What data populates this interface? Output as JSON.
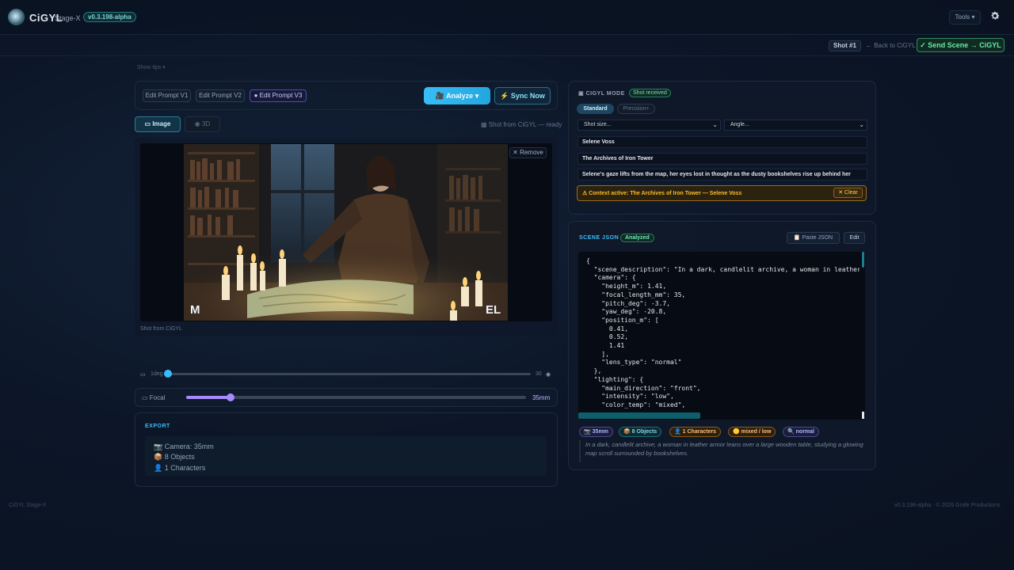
{
  "app": {
    "brand": "CiGYL",
    "stage": "Stage-X",
    "version": "v0.3.198-alpha",
    "tools_label": "Tools",
    "show_tips": "Show tips"
  },
  "subbar": {
    "shot_badge": "Shot #1",
    "back_link": "← Back to CiGYL",
    "send_button": "✓ Send Scene → CiGYL"
  },
  "editor": {
    "prompt_versions": [
      "Edit Prompt V1",
      "Edit Prompt V2",
      "● Edit Prompt V3"
    ],
    "analyze_label": "Analyze",
    "sync_label": "Sync Now",
    "tabs": {
      "image": "Image",
      "threeD": "3D"
    },
    "shot_status": "Shot from CiGYL — ready",
    "remove_label": "✕ Remove",
    "image_labels": {
      "left": "M",
      "right": "EL"
    },
    "image_caption": "Shot from CiGYL"
  },
  "sliders": {
    "deg_low": "1deg",
    "deg_high": "30",
    "deg_value": 0,
    "focal_label": "Focal",
    "focal_value_text": "35mm",
    "focal_fraction": 0.13
  },
  "export": {
    "title": "EXPORT",
    "camera": "Camera: 35mm",
    "objects": "8 Objects",
    "characters": "1 Characters"
  },
  "mode": {
    "title": "CIGYL MODE",
    "badge": "Shot received",
    "standard": "Standard",
    "precision": "Precision+",
    "shot_size_placeholder": "Shot size...",
    "angle_placeholder": "Angle...",
    "character": "Selene Voss",
    "location": "The Archives of Iron Tower",
    "description": "Selene's gaze lifts from the map, her eyes lost in thought as the dusty bookshelves rise up behind her",
    "context_text": "⚠ Context active: The Archives of Iron Tower — Selene Voss",
    "clear_label": "✕ Clear"
  },
  "scene_json": {
    "title": "SCENE JSON",
    "badge": "Analyzed",
    "paste_label": "Paste JSON",
    "edit_label": "Edit",
    "code": "{\n  \"scene_description\": \"In a dark, candlelit archive, a woman in leather\n  \"camera\": {\n    \"height_m\": 1.41,\n    \"focal_length_mm\": 35,\n    \"pitch_deg\": -3.7,\n    \"yaw_deg\": -20.8,\n    \"position_m\": [\n      0.41,\n      0.52,\n      1.41\n    ],\n    \"lens_type\": \"normal\"\n  },\n  \"lighting\": {\n    \"main_direction\": \"front\",\n    \"intensity\": \"low\",\n    \"color_temp\": \"mixed\",",
    "chips": [
      "📷 35mm",
      "📦 8 Objects",
      "👤 1 Characters",
      "🟡 mixed / low",
      "🔍 normal"
    ],
    "summary": "In a dark, candlelit archive, a woman in leather armor leans over a large wooden table, studying a glowing map scroll surrounded by bookshelves."
  },
  "footer": {
    "left": "CiGYL Stage-X",
    "right": "v0.3.198-alpha · © 2026 Grafe Productions"
  }
}
